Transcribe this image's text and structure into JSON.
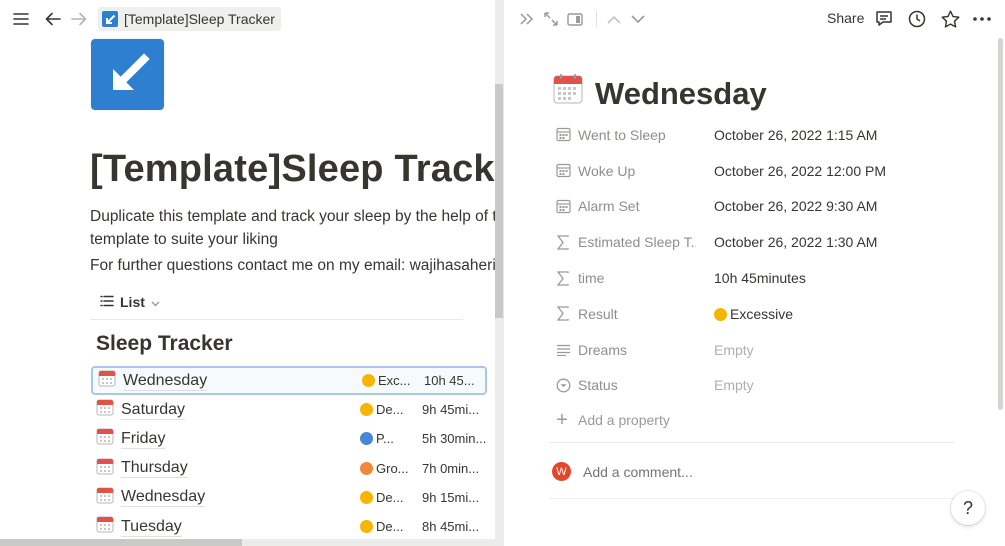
{
  "left": {
    "breadcrumb": "[Template]Sleep Tracker",
    "title": "[Template]Sleep Tracker",
    "description": "Duplicate this template and track your sleep by the help of th template to suite your liking",
    "contact": "For further questions contact me on my email: wajihasaherish",
    "view_label": "List",
    "database_title": "Sleep Tracker",
    "rows": [
      {
        "name": "Wednesday",
        "result": "Exc...",
        "time": "10h 45..."
      },
      {
        "name": "Saturday",
        "result": "De...",
        "time": "9h 45mi..."
      },
      {
        "name": "Friday",
        "result": "P...",
        "time": "5h 30min..."
      },
      {
        "name": "Thursday",
        "result": "Gro...",
        "time": "7h 0min..."
      },
      {
        "name": "Wednesday",
        "result": "De...",
        "time": "9h 15mi..."
      },
      {
        "name": "Tuesday",
        "result": "De...",
        "time": "8h 45mi..."
      }
    ]
  },
  "right": {
    "share_label": "Share",
    "title": "Wednesday",
    "properties": [
      {
        "name": "Went to Sleep",
        "value": "October 26, 2022 1:15 AM",
        "icon": "calendar-icon"
      },
      {
        "name": "Woke Up",
        "value": "October 26, 2022 12:00 PM",
        "icon": "calendar-icon"
      },
      {
        "name": "Alarm Set",
        "value": "October 26, 2022 9:30 AM",
        "icon": "calendar-icon"
      },
      {
        "name": "Estimated Sleep T...",
        "value": "October 26, 2022 1:30 AM",
        "icon": "formula-icon"
      },
      {
        "name": "time",
        "value": "10h 45minutes",
        "icon": "formula-icon"
      },
      {
        "name": "Result",
        "value": "Excessive",
        "icon": "formula-icon"
      },
      {
        "name": "Dreams",
        "value": "Empty",
        "icon": "text-lines-icon"
      },
      {
        "name": "Status",
        "value": "Empty",
        "icon": "status-icon"
      }
    ],
    "add_property_label": "Add a property",
    "avatar_initial": "W",
    "comment_placeholder": "Add a comment...",
    "help_label": "?"
  },
  "colors": {
    "accent_blue": "#2f7fd1",
    "text": "#37352f",
    "muted": "#8f8e8a",
    "avatar": "#e2472b"
  }
}
